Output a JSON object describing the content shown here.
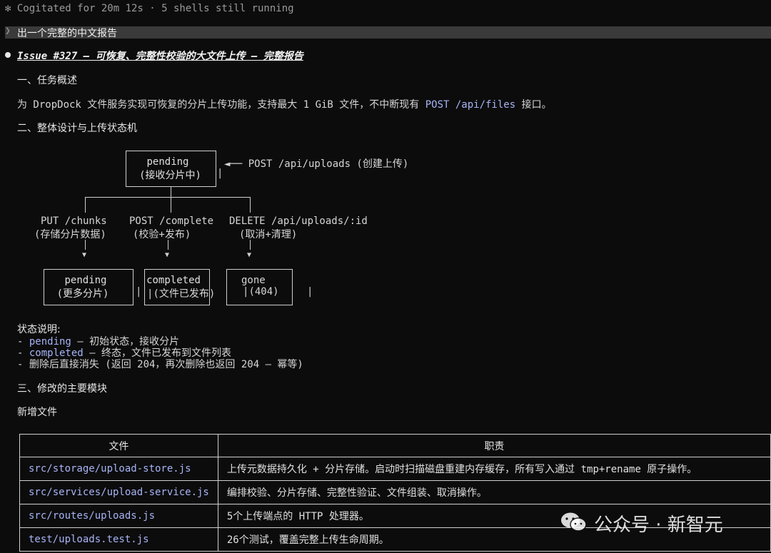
{
  "status_line": "✻ Cogitated for 20m 12s · 5 shells still running",
  "prompt": "出一个完整的中文报告",
  "issue_title": "Issue #327 — 可恢复、完整性校验的大文件上传 — 完整报告",
  "section1": {
    "heading": "一、任务概述",
    "text_pre": "为 DropDock 文件服务实现可恢复的分片上传功能，支持最大 1 GiB 文件，不中断现有 ",
    "code": "POST /api/files",
    "text_post": " 接口。"
  },
  "section2": {
    "heading": "二、整体设计与上传状态机",
    "diagram": {
      "top_box_line1": "pending",
      "top_box_line2": "(接收分片中)",
      "top_annotation": "◄── POST /api/uploads (创建上传)",
      "branches": [
        {
          "line1": "PUT /chunks",
          "line2": "(存储分片数据)"
        },
        {
          "line1": "POST /complete",
          "line2": "(校验+发布)"
        },
        {
          "line1": "DELETE /api/uploads/:id",
          "line2": "(取消+清理)"
        }
      ],
      "bottom_boxes": [
        {
          "line1": "pending",
          "line2": "(更多分片)"
        },
        {
          "line1": "completed",
          "line2": "(文件已发布)"
        },
        {
          "line1": "gone",
          "line2": "(404)"
        }
      ]
    },
    "notes_title": "状态说明:",
    "notes": [
      {
        "prefix": "- ",
        "code": "pending",
        "text": " — 初始状态，接收分片"
      },
      {
        "prefix": "- ",
        "code": "completed",
        "text": " — 终态，文件已发布到文件列表"
      },
      {
        "prefix": "- ",
        "code": "",
        "text": "删除后直接消失 (返回 204，再次删除也返回 204 — 幂等)"
      }
    ]
  },
  "section3": {
    "heading": "三、修改的主要模块",
    "subheading": "新增文件",
    "table": {
      "headers": [
        "文件",
        "职责"
      ],
      "rows": [
        [
          "src/storage/upload-store.js",
          "上传元数据持久化 + 分片存储。启动时扫描磁盘重建内存缓存，所有写入通过 tmp+rename 原子操作。"
        ],
        [
          "src/services/upload-service.js",
          "编排校验、分片存储、完整性验证、文件组装、取消操作。"
        ],
        [
          "src/routes/uploads.js",
          "5个上传端点的 HTTP 处理器。"
        ],
        [
          "test/uploads.test.js",
          "26个测试，覆盖完整上传生命周期。"
        ]
      ]
    }
  },
  "watermark": "公众号 · 新智元"
}
